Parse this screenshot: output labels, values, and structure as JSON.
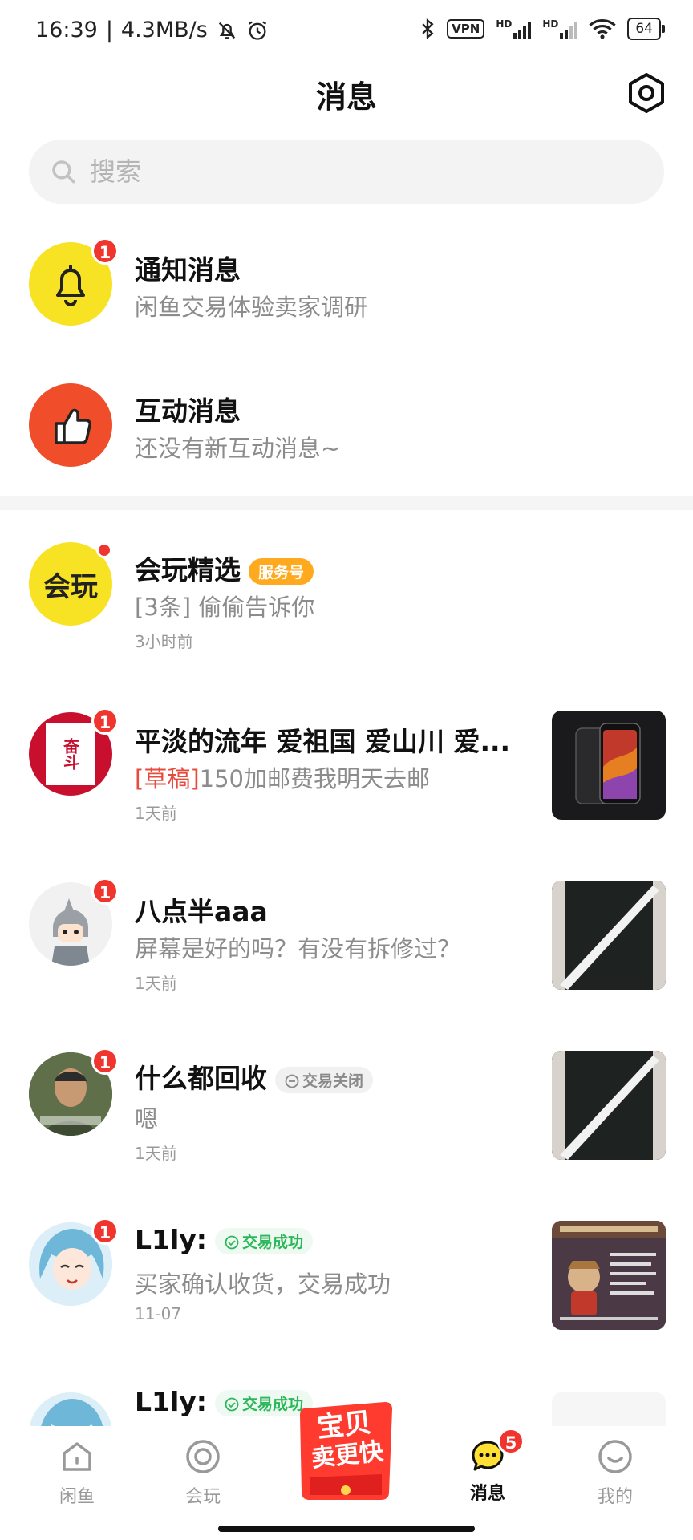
{
  "status": {
    "time": "16:39",
    "speed": "4.3MB/s",
    "vpn": "VPN",
    "hd": "HD",
    "battery": "64"
  },
  "header": {
    "title": "消息"
  },
  "search": {
    "placeholder": "搜索"
  },
  "system": [
    {
      "title": "通知消息",
      "subtitle": "闲鱼交易体验卖家调研",
      "badge": "1",
      "color": "#f8e224"
    },
    {
      "title": "互动消息",
      "subtitle": "还没有新互动消息~",
      "color": "#f04e2a"
    }
  ],
  "conversations": [
    {
      "name": "会玩精选",
      "tag": "服务号",
      "preview": "[3条] 偷偷告诉你",
      "time": "3小时前",
      "avatar_text": "会玩"
    },
    {
      "name": "平淡的流年 爱祖国 爱山川 爱...",
      "draft": "[草稿]",
      "preview": "150加邮费我明天去邮",
      "time": "1天前",
      "badge": "1",
      "avatar_text": "奋斗"
    },
    {
      "name": "八点半aaa",
      "preview": "屏幕是好的吗？有没有拆修过？",
      "time": "1天前",
      "badge": "1"
    },
    {
      "name": "什么都回收",
      "tag": "交易关闭",
      "preview": "嗯",
      "time": "1天前",
      "badge": "1"
    },
    {
      "name": "L1ly:",
      "tag": "交易成功",
      "preview": "买家确认收货，交易成功",
      "time": "11-07",
      "badge": "1"
    },
    {
      "name": "L1ly:",
      "tag": "交易成功"
    }
  ],
  "tabbar": {
    "tabs": [
      {
        "label": "闲鱼"
      },
      {
        "label": "会玩"
      },
      {
        "label": "消息",
        "badge": "5"
      },
      {
        "label": "我的"
      }
    ],
    "sell_line1": "宝贝",
    "sell_line2": "卖更快"
  }
}
